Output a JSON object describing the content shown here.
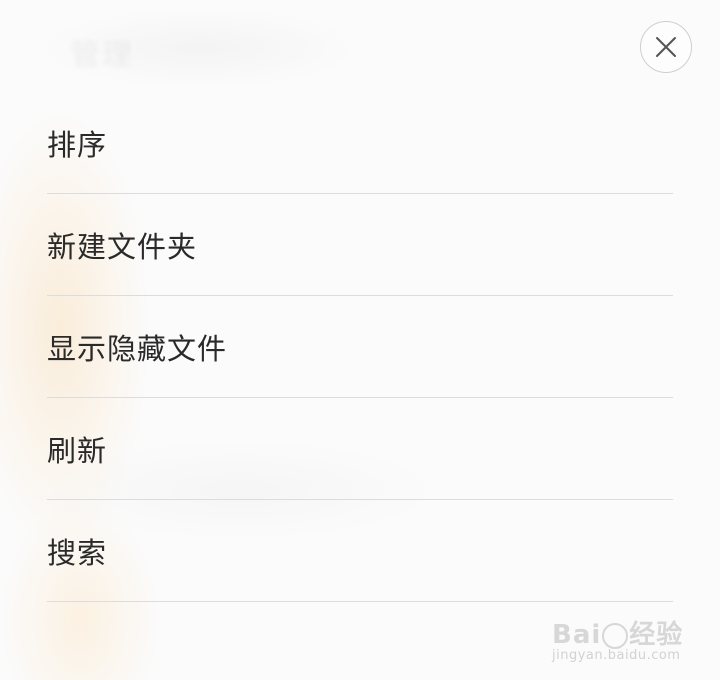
{
  "header": {
    "title": "管理",
    "close_icon": "close-icon"
  },
  "menu": {
    "items": [
      {
        "label": "排序"
      },
      {
        "label": "新建文件夹"
      },
      {
        "label": "显示隐藏文件"
      },
      {
        "label": "刷新"
      },
      {
        "label": "搜索"
      }
    ]
  },
  "watermark": {
    "brand_left": "Bai",
    "brand_right": "经验",
    "url": "jingyan.baidu.com"
  }
}
